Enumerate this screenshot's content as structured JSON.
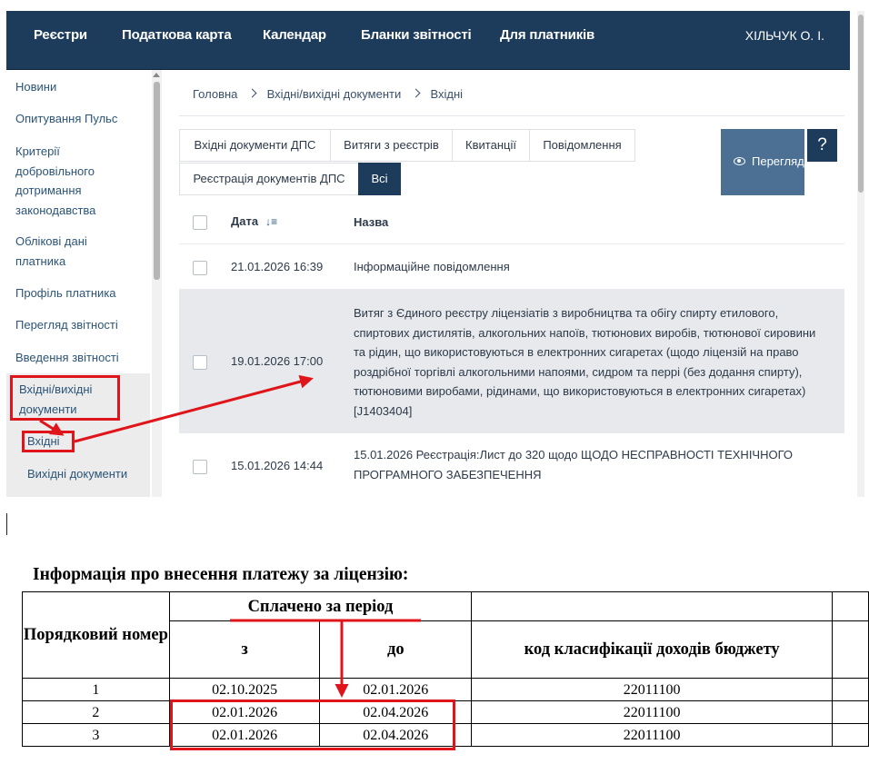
{
  "topnav": {
    "items": [
      "Реєстри",
      "Податкова карта",
      "Календар",
      "Бланки звітності",
      "Для платників"
    ],
    "user": "ХІЛЬЧУК О. І."
  },
  "sidebar": {
    "items": [
      "Новини",
      "Опитування Пульс",
      "Критерії добровільного дотримання законодавства",
      "Облікові дані платника",
      "Профіль платника",
      "Перегляд звітності",
      "Введення звітності",
      "Вхідні/вихідні документи"
    ],
    "subitems": [
      "Вхідні",
      "Вихідні документи"
    ]
  },
  "breadcrumb": [
    "Головна",
    "Вхідні/вихідні документи",
    "Вхідні"
  ],
  "tabs": [
    "Вхідні документи ДПС",
    "Витяги з реєстрів",
    "Квитанції",
    "Повідомлення",
    "Реєстрація документів ДПС",
    "Всі"
  ],
  "view_button": "Перегляд",
  "help_button": "?",
  "table": {
    "headers": {
      "date": "Дата",
      "name": "Назва"
    },
    "rows": [
      {
        "date": "21.01.2026 16:39",
        "name": "Інформаційне повідомлення"
      },
      {
        "date": "19.01.2026 17:00",
        "name": "Витяг з Єдиного реєстру ліцензіатів з виробництва та обігу спирту етилового, спиртових дистилятів, алкогольних напоїв, тютюнових виробів, тютюнової сировини та рідин, що використовуються в електронних сигаретах (щодо ліцензій на право роздрібної торгівлі алкогольними напоями, сидром та перрі (без додання спирту), тютюновими виробами, рідинами, що використовуються в електронних сигаретах) [J1403404]"
      },
      {
        "date": "15.01.2026 14:44",
        "name": "15.01.2026 Реєстрація:Лист до 320 щодо ЩОДО НЕСПРАВНОСТІ ТЕХНІЧНОГО ПРОГРАМНОГО ЗАБЕЗПЕЧЕННЯ"
      }
    ]
  },
  "document": {
    "title": "Інформація про внесення платежу за ліцензію:",
    "headers": {
      "number": "Порядковий номер",
      "period": "Сплачено за період",
      "from": "з",
      "to": "до",
      "code": "код класифікації доходів бюджету"
    },
    "rows": [
      {
        "number": "1",
        "from": "02.10.2025",
        "to": "02.01.2026",
        "code": "22011100"
      },
      {
        "number": "2",
        "from": "02.01.2026",
        "to": "02.04.2026",
        "code": "22011100"
      },
      {
        "number": "3",
        "from": "02.01.2026",
        "to": "02.04.2026",
        "code": "22011100"
      }
    ]
  },
  "colors": {
    "nav_bg": "#1d3c5c",
    "view_button_bg": "#4b7094",
    "annotation_red": "#e0141b",
    "highlight_row": "#e7e9ec"
  }
}
